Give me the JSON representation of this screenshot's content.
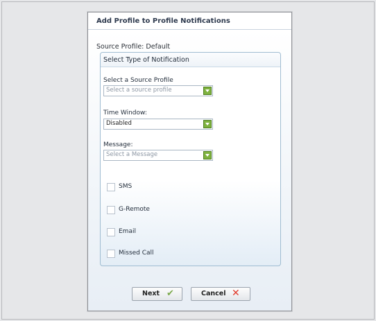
{
  "dialog": {
    "title": "Add Profile to Profile Notifications",
    "source_profile_text": "Source Profile: Default"
  },
  "group": {
    "title": "Select Type of Notification",
    "fields": [
      {
        "label": "Select a Source Profile",
        "value": "Select a source profile",
        "placeholder": true
      },
      {
        "label": "Time Window:",
        "value": "Disabled",
        "placeholder": false
      },
      {
        "label": "Message:",
        "value": "Select a Message",
        "placeholder": true
      }
    ],
    "checkboxes": [
      {
        "label": "SMS",
        "checked": false
      },
      {
        "label": "G-Remote",
        "checked": false
      },
      {
        "label": "Email",
        "checked": false
      },
      {
        "label": "Missed Call",
        "checked": false
      }
    ]
  },
  "buttons": {
    "next_label": "Next",
    "next_icon": "checkmark-icon",
    "cancel_label": "Cancel",
    "cancel_icon": "x-icon"
  },
  "colors": {
    "dropdown_button": "#7fb23e",
    "next_check": "#7aa84a",
    "cancel_x": "#e13a2b",
    "group_border": "#9fbcd1"
  }
}
